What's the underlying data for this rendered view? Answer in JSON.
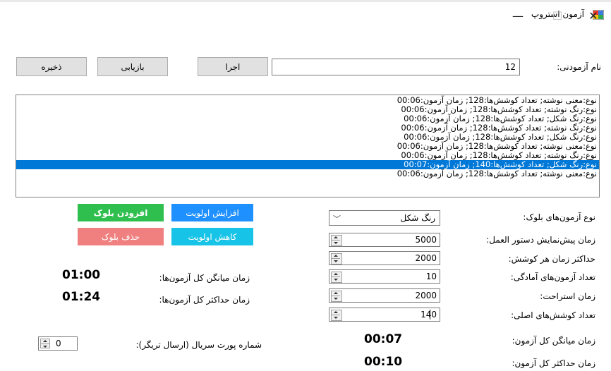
{
  "window": {
    "title": "آزمون استروپ",
    "minimize": "—",
    "maximize": "☐",
    "close": "✕"
  },
  "toolbar": {
    "subject_label": "نام آزمودنی:",
    "subject_value": "12",
    "run_label": "اجرا",
    "load_label": "بازیابی",
    "save_label": "ذخیره"
  },
  "blocks": [
    "نوع:معنی نوشته; تعداد کوشش‌ها:128; زمان آزمون:00:06",
    "نوع:رنگ نوشته; تعداد کوشش‌ها:128; زمان آزمون:00:06",
    "نوع:رنگ شکل; تعداد کوشش‌ها:128; زمان آزمون:00:06",
    "نوع:رنگ نوشته; تعداد کوشش‌ها:128; زمان آزمون:00:06",
    "نوع:رنگ شکل; تعداد کوشش‌ها:128; زمان آزمون:00:06",
    "نوع:معنی نوشته; تعداد کوشش‌ها:128; زمان آزمون:00:06",
    "نوع:رنگ نوشته; تعداد کوشش‌ها:128; زمان آزمون:00:06",
    "نوع:رنگ شکل; تعداد کوشش‌ها:140; زمان آزمون:00:07",
    "نوع:معنی نوشته; تعداد کوشش‌ها:128; زمان آزمون:00:06"
  ],
  "selected_block_index": 7,
  "settings": {
    "block_type_label": "نوع آزمون‌های بلوک:",
    "block_type_value": "رنگ شکل",
    "preview_label": "زمان پیش‌نمایش  دستور العمل:",
    "preview_value": "5000",
    "max_trial_label": "حداکثر زمان هر کوشش:",
    "max_trial_value": "2000",
    "practice_label": "تعداد آزمون‌های آمادگی:",
    "practice_value": "10",
    "rest_label": "زمان استراحت:",
    "rest_value": "2000",
    "main_trials_label": "تعداد کوشش‌های اصلی:",
    "main_trials_value": "140",
    "avg_test_label": "زمان میانگن کل آزمون:",
    "avg_test_value": "00:07",
    "max_test_label": "زمان حداکثر کل آزمون:",
    "max_test_value": "00:10"
  },
  "actions": {
    "add_block": "افزودن بلوک",
    "delete_block": "حذف بلوک",
    "increase_priority": "افزایش اولویت",
    "decrease_priority": "کاهش اولویت"
  },
  "totals": {
    "avg_all_label": "زمان میانگن کل آزمون‌ها:",
    "avg_all_value": "01:00",
    "max_all_label": "زمان حداکثر کل آزمون‌ها:",
    "max_all_value": "01:24"
  },
  "serial": {
    "label": "شماره پورت سریال (ارسال تریگر):",
    "value": "0"
  },
  "colors": {
    "selection": "#0078d7",
    "add_green": "#2fbf4f",
    "delete_red": "#f08080",
    "priority_blue": "#1e90ff",
    "priority_cyan": "#17c3e6"
  }
}
